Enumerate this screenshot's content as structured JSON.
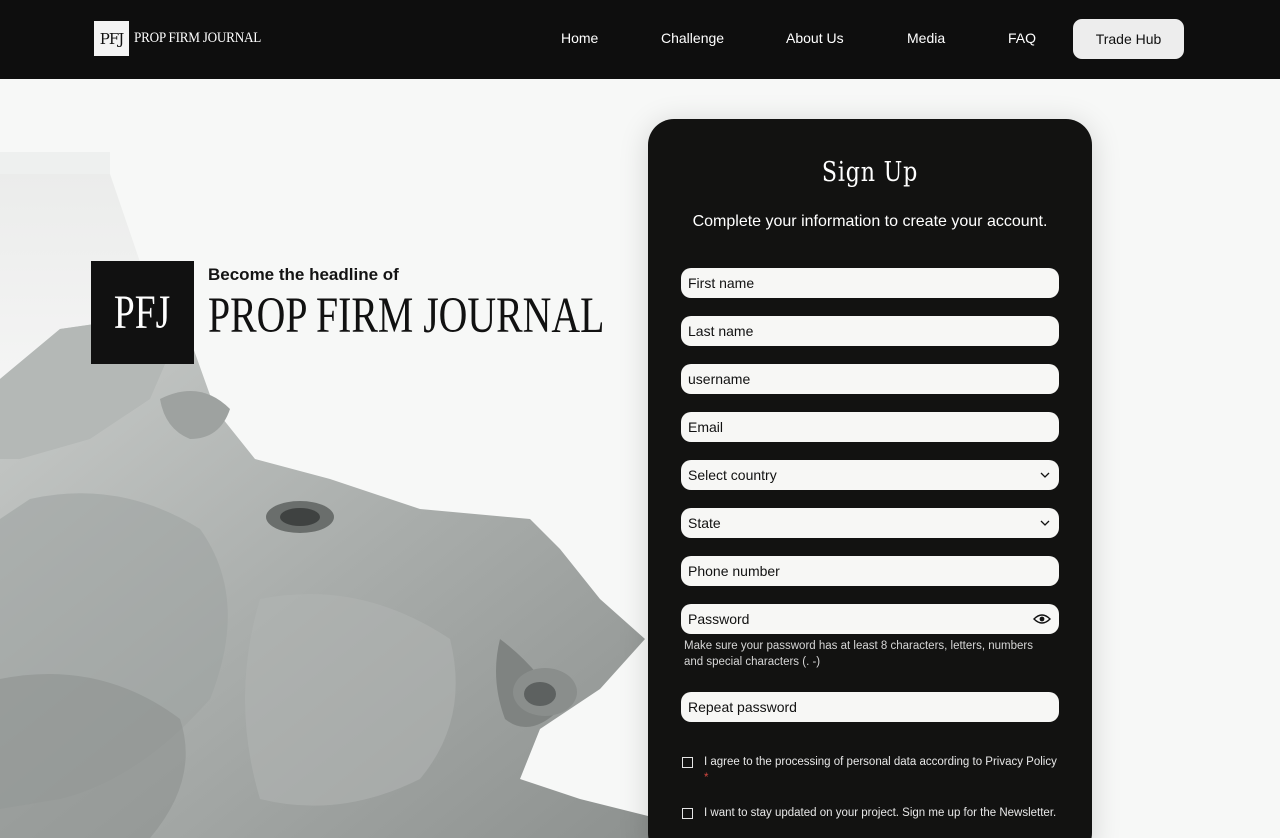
{
  "header": {
    "logo_mark": "PFJ",
    "logo_text": "PROP FIRM JOURNAL",
    "nav": [
      "Home",
      "Challenge",
      "About Us",
      "Media",
      "FAQ"
    ],
    "cta": "Trade Hub"
  },
  "hero": {
    "mark": "PFJ",
    "subtitle": "Become the headline of",
    "title": "PROP FIRM JOURNAL"
  },
  "signup": {
    "title": "Sign Up",
    "subtitle": "Complete your information to create your account.",
    "fields": {
      "first_name": "First name",
      "last_name": "Last name",
      "username": "username",
      "email": "Email",
      "country": "Select country",
      "state": "State",
      "phone": "Phone number",
      "password": "Password",
      "repeat_password": "Repeat password"
    },
    "password_hint": "Make sure your password has at least 8 characters, letters, numbers and special characters (. -)",
    "privacy_label": "I agree to the processing of personal data according to Privacy Policy",
    "required_mark": "*",
    "newsletter_label": "I want to stay updated on your project. Sign me up for the Newsletter."
  },
  "icons": {
    "select_caret": "chevron-down-icon",
    "password_toggle": "eye-icon"
  },
  "colors": {
    "header_bg": "#0e0e0e",
    "card_bg": "#121211",
    "page_bg": "#f7f8f7",
    "required": "#d0473f"
  }
}
